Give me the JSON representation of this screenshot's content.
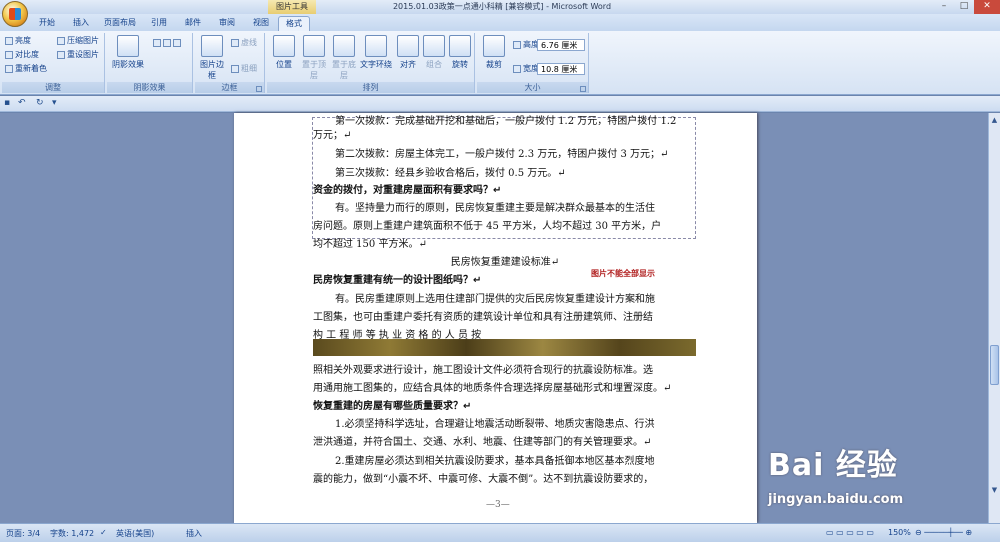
{
  "window": {
    "title": "2015.01.03政策一点通小科精 [兼容模式] - Microsoft Word",
    "context_tab": "图片工具",
    "controls": [
      "–",
      "□",
      "✕"
    ]
  },
  "tabs": [
    {
      "label": "开始"
    },
    {
      "label": "插入"
    },
    {
      "label": "页面布局"
    },
    {
      "label": "引用"
    },
    {
      "label": "邮件"
    },
    {
      "label": "审阅"
    },
    {
      "label": "视图"
    },
    {
      "label": "格式",
      "active": true
    }
  ],
  "ribbon": {
    "adjust": {
      "label": "调整",
      "items": [
        "亮度",
        "对比度",
        "重新着色",
        "压缩图片",
        "重设图片"
      ]
    },
    "picture_styles": {
      "label": "阴影效果",
      "shadow_button": "阴影效果"
    },
    "border": {
      "label": "边框",
      "items": [
        "图片边框",
        "虚线",
        "粗细"
      ]
    },
    "arrange": {
      "label": "排列",
      "items": [
        "位置",
        "置于顶层",
        "置于底层",
        "文字环绕",
        "对齐",
        "组合",
        "旋转"
      ]
    },
    "size": {
      "label": "大小",
      "crop": "裁剪",
      "height_label": "高度:",
      "height_value": "6.76 厘米",
      "width_label": "宽度:",
      "width_value": "10.8 厘米"
    }
  },
  "document": {
    "lines": [
      "第一次拨款：完成基础开挖和基础后，一般户拨付 1.2 万元，特困户拨付 1.2",
      "万元；↵",
      "第二次拨款：房屋主体完工，一般户拨付 2.3 万元，特困户拨付 3 万元；↵",
      "第三次拨款：经县乡验收合格后，拨付 0.5 万元。↵",
      "资金的拨付，对重建房屋面积有要求吗？↵",
      "有。坚持量力而行的原则，民房恢复重建主要是解决群众最基本的生活住",
      "房问题。原则上重建户建筑面积不低于 45 平方米，人均不超过 30 平方米，户",
      "均不超过 150 平方米。↵",
      "民房恢复重建建设标准↵",
      "民房恢复重建有统一的设计图纸吗？↵",
      "有。民房重建原则上选用住建部门提供的灾后民房恢复重建设计方案和施",
      "工图集，也可由重建户委托有资质的建筑设计单位和具有注册建筑师、注册结",
      "构 工 程 师 等 执 业 资 格 的 人 员 按",
      "照相关外观要求进行设计，施工图设计文件必须符合现行的抗震设防标准。选",
      "用通用施工图集的，应结合具体的地质条件合理选择房屋基础形式和埋置深度。↵",
      "恢复重建的房屋有哪些质量要求？↵",
      "1.必须坚持科学选址，合理避让地震活动断裂带、地质灾害隐患点、行洪",
      "泄洪通道，并符合国土、交通、水利、地震、住建等部门的有关管理要求。↵",
      "2.重建房屋必须达到相关抗震设防要求，基本具备抵御本地区基本烈度地",
      "震的能力，做到“小震不坏、中震可修、大震不倒”。达不到抗震设防要求的，"
    ],
    "photo_note": "图片不能全部显示",
    "page_number": "—3—"
  },
  "statusbar": {
    "page": "页面: 3/4",
    "words": "字数: 1,472",
    "language": "英语(美国)",
    "mode": "插入",
    "zoom": "150%"
  },
  "watermark": {
    "brand": "Bai 经验",
    "url": "jingyan.baidu.com"
  },
  "colors": {
    "ribbon": "#d6e3f4",
    "workspace": "#7a8fb6",
    "accent": "#15428b"
  }
}
